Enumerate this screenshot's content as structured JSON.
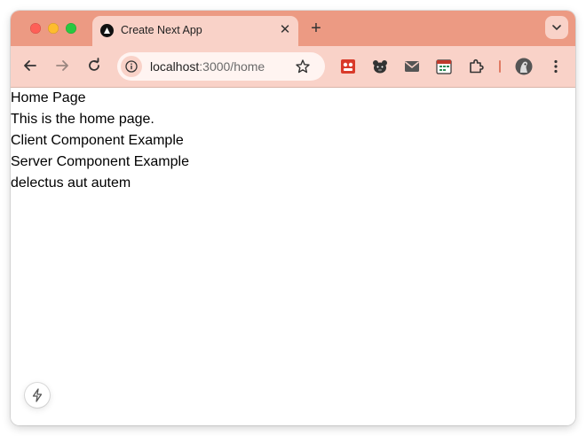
{
  "browser": {
    "tab": {
      "title": "Create Next App",
      "close_glyph": "✕"
    },
    "new_tab_glyph": "+",
    "address": {
      "host": "localhost",
      "rest": ":3000/home"
    },
    "icons": [
      "back-arrow-icon",
      "forward-arrow-icon",
      "reload-icon",
      "site-info-icon",
      "bookmark-star-icon",
      "tab-search-chevron-icon",
      "extensions-puzzle-icon",
      "profile-avatar-icon",
      "kebab-menu-icon"
    ],
    "extensions": [
      "red-extension-icon",
      "bear-extension-icon",
      "mail-extension-icon",
      "calendar-extension-icon"
    ],
    "colors": {
      "tabbar": "#ec9a83",
      "toolbar": "#f9d2c8",
      "omnibox": "#fff4f1"
    }
  },
  "page": {
    "lines": [
      "Home Page",
      "This is the home page.",
      "Client Component Example",
      "Server Component Example",
      "delectus aut autem"
    ]
  },
  "dev_indicator": {
    "icon": "lightning-bolt-icon"
  }
}
